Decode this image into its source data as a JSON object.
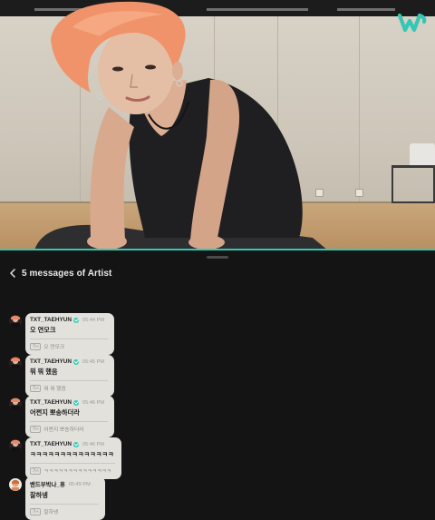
{
  "header": {
    "title": "5 messages of Artist"
  },
  "colors": {
    "accent": "#35c7b4",
    "panel_bg": "#141414",
    "bubble_bg": "#e2e1dc"
  },
  "icons": {
    "logo": "weverse-logo-icon",
    "back": "chevron-left-icon",
    "verified": "verified-badge-icon",
    "translate": "translate-icon"
  },
  "messages": [
    {
      "sender": "TXT_TAEHYUN",
      "verified": true,
      "time": "05:44 PM",
      "text": "오 연모크",
      "translate_badge": "가A",
      "translation": "오 연모크"
    },
    {
      "sender": "TXT_TAEHYUN",
      "verified": true,
      "time": "05:45 PM",
      "text": "뭐 뭐 했음",
      "translate_badge": "가A",
      "translation": "뭐 뭐 했음"
    },
    {
      "sender": "TXT_TAEHYUN",
      "verified": true,
      "time": "05:46 PM",
      "text": "어쩐지 뽀송하더라",
      "translate_badge": "가A",
      "translation": "어쩐지 뽀송하더라"
    },
    {
      "sender": "TXT_TAEHYUN",
      "verified": true,
      "time": "05:46 PM",
      "text": "ㅋㅋㅋㅋㅋㅋㅋㅋㅋㅋㅋㅋㅋㅋ",
      "translate_badge": "가A",
      "translation": "ㅋㅋㅋㅋㅋㅋㅋㅋㅋㅋㅋㅋㅋㅋ"
    },
    {
      "sender": "밴드부박나_휴",
      "verified": false,
      "time": "05:49 PM",
      "text": "잘하넹",
      "translate_badge": "가A",
      "translation": "잘하넹"
    }
  ]
}
